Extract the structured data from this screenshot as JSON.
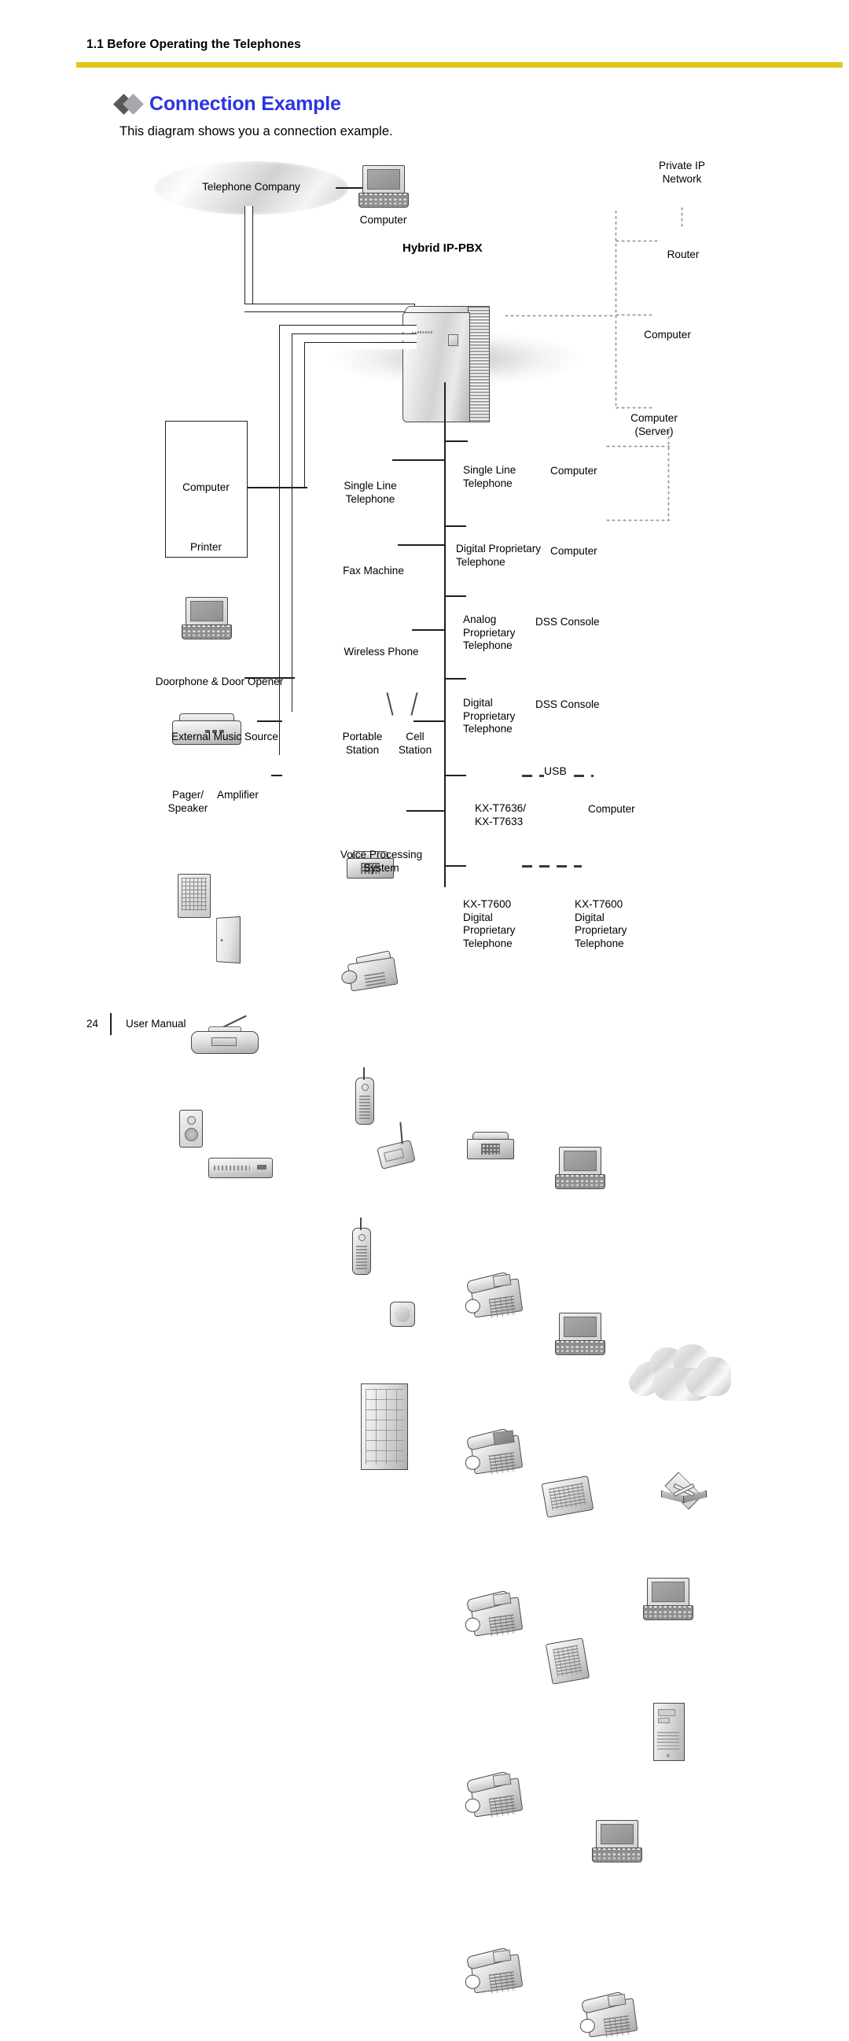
{
  "header": {
    "section": "1.1 Before Operating the Telephones"
  },
  "title": {
    "heading": "Connection Example",
    "intro": "This diagram shows you a connection example."
  },
  "footer": {
    "page_number": "24",
    "label": "User Manual"
  },
  "diagram": {
    "telephone_company": "Telephone Company",
    "top_computer": "Computer",
    "pbx": "Hybrid IP-PBX",
    "private_ip_network": "Private IP\nNetwork",
    "router": "Router",
    "ip_computer": "Computer",
    "server": "Computer\n(Server)",
    "left_box": {
      "computer": "Computer",
      "printer": "Printer"
    },
    "doorphone": "Doorphone & Door Opener",
    "external_music_source": "External Music Source",
    "pager_speaker": "Pager/\nSpeaker",
    "amplifier": "Amplifier",
    "single_line_telephone": "Single Line\nTelephone",
    "fax_machine": "Fax Machine",
    "wireless_phone": "Wireless Phone",
    "portable_station": "Portable\nStation",
    "cell_station": "Cell\nStation",
    "voice_processing_system": "Voice Processing\nSystem",
    "right_single_line_telephone": "Single Line\nTelephone",
    "right_computer_1": "Computer",
    "digital_proprietary_telephone": "Digital Proprietary\nTelephone",
    "right_computer_2": "Computer",
    "analog_proprietary_telephone": "Analog\nProprietary\nTelephone",
    "dss_console_1": "DSS Console",
    "digital_proprietary_telephone_2": "Digital\nProprietary\nTelephone",
    "dss_console_2": "DSS Console",
    "kx_t7636": "KX-T7636/\nKX-T7633",
    "usb": "USB",
    "usb_computer": "Computer",
    "kx_t7600_left": "KX-T7600\nDigital\nProprietary\nTelephone",
    "kx_t7600_right": "KX-T7600\nDigital\nProprietary\nTelephone"
  },
  "colors": {
    "rule": "#E3C51B",
    "title": "#2B34E0",
    "diamond_dark": "#58585A",
    "diamond_light": "#A6A8AB",
    "line": "#231F20"
  }
}
